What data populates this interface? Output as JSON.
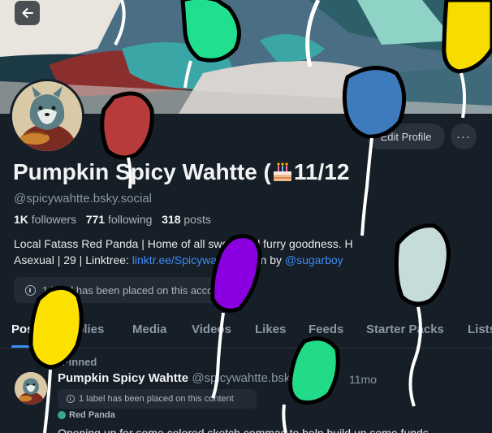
{
  "profile": {
    "display_name": "Pumpkin Spicy Wahtte (",
    "display_name_suffix": "11/12",
    "handle": "@spicywahtte.bsky.social",
    "followers_count": "1K",
    "followers_label": "followers",
    "following_count": "771",
    "following_label": "following",
    "posts_count": "318",
    "posts_label": "posts",
    "bio_line1": "Local Fatass Red Panda | Home of all sweet and furry goodness. H",
    "bio_line2_prefix": "Asexual | 29 | Linktree: ",
    "bio_link": "linktr.ee/Spicywahtte",
    "bio_mid": " | Icon by ",
    "bio_link2": "@sugarboy",
    "label_notice": "1 label has been placed on this account"
  },
  "actions": {
    "back_icon": "arrow-left-icon",
    "edit_profile": "Edit Profile",
    "more": "···"
  },
  "tabs": [
    "Posts",
    "Replies",
    "Media",
    "Videos",
    "Likes",
    "Feeds",
    "Starter Packs",
    "Lists"
  ],
  "post": {
    "pinned_label": "Pinned",
    "author_name": "Pumpkin Spicy Wahtte",
    "author_handle": "@spicywahtte.bsky.social",
    "time": "11mo",
    "label_notice": "1 label has been placed on this content",
    "self_label": "Red Panda",
    "text": "Opening up for some colored sketch commas to help build up some funds"
  },
  "colors": {
    "background": "#161e27",
    "accent": "#3b8cf5",
    "balloon_colors": [
      "#20e08f",
      "#f7dc00",
      "#b83b3b",
      "#3d7bbd",
      "#8b00e0",
      "#c5dcd8",
      "#fde100",
      "#22db88"
    ]
  }
}
